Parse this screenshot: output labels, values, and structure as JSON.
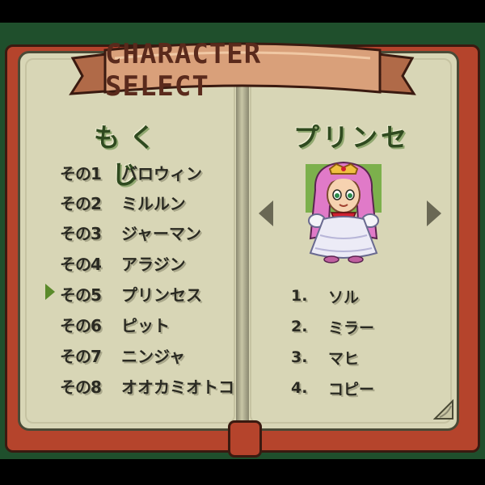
{
  "title": "CHARACTER SELECT",
  "toc": {
    "heading": "もくじ",
    "selected_index": 4,
    "items": [
      {
        "num": "その1",
        "name": "バロウィン"
      },
      {
        "num": "その2",
        "name": "ミルルン"
      },
      {
        "num": "その3",
        "name": "ジャーマン"
      },
      {
        "num": "その4",
        "name": "アラジン"
      },
      {
        "num": "その5",
        "name": "プリンセス"
      },
      {
        "num": "その6",
        "name": "ピット"
      },
      {
        "num": "その7",
        "name": "ニンジャ"
      },
      {
        "num": "その8",
        "name": "オオカミオトコ"
      }
    ]
  },
  "detail": {
    "name": "プリンセス",
    "portrait_icon": "princess-portrait-icon",
    "options": [
      {
        "num": "1.",
        "label": "ソル"
      },
      {
        "num": "2.",
        "label": "ミラー"
      },
      {
        "num": "3.",
        "label": "マヒ"
      },
      {
        "num": "4.",
        "label": "コピー"
      }
    ]
  },
  "colors": {
    "background": "#1f4f2c",
    "book_cover": "#b5442c",
    "page": "#d8d6b6",
    "heading_green": "#2f4a1f",
    "cursor": "#5a8a2a"
  }
}
